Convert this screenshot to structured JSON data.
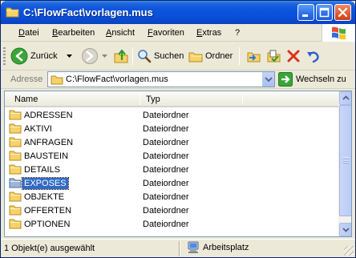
{
  "window": {
    "title": "C:\\FlowFact\\vorlagen.mus"
  },
  "menu": [
    "Datei",
    "Bearbeiten",
    "Ansicht",
    "Favoriten",
    "Extras",
    "?"
  ],
  "toolbar": {
    "back_label": "Zurück",
    "search_label": "Suchen",
    "folders_label": "Ordner"
  },
  "address": {
    "label": "Adresse",
    "value": "C:\\FlowFact\\vorlagen.mus",
    "go_label": "Wechseln zu"
  },
  "list": {
    "columns": {
      "name": "Name",
      "type": "Typ"
    },
    "rows": [
      {
        "name": "ADRESSEN",
        "type": "Dateiordner",
        "selected": false
      },
      {
        "name": "AKTIVI",
        "type": "Dateiordner",
        "selected": false
      },
      {
        "name": "ANFRAGEN",
        "type": "Dateiordner",
        "selected": false
      },
      {
        "name": "BAUSTEIN",
        "type": "Dateiordner",
        "selected": false
      },
      {
        "name": "DETAILS",
        "type": "Dateiordner",
        "selected": false
      },
      {
        "name": "EXPOSES",
        "type": "Dateiordner",
        "selected": true
      },
      {
        "name": "OBJEKTE",
        "type": "Dateiordner",
        "selected": false
      },
      {
        "name": "OFFERTEN",
        "type": "Dateiordner",
        "selected": false
      },
      {
        "name": "OPTIONEN",
        "type": "Dateiordner",
        "selected": false
      }
    ]
  },
  "status": {
    "selection": "1 Objekt(e) ausgewählt",
    "location": "Arbeitsplatz"
  },
  "colors": {
    "titlebar": "#0a4fd8",
    "selection": "#316ac5",
    "folder": "#f5d36a"
  }
}
